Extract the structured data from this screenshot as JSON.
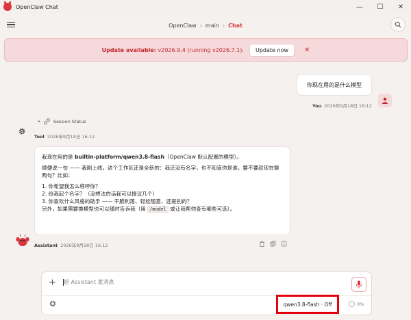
{
  "window": {
    "title": "OpenClaw Chat",
    "icon": "lobster-icon",
    "controls": [
      "—",
      "☐",
      "✕"
    ]
  },
  "header": {
    "breadcrumb": [
      "OpenClaw",
      "main",
      "Chat"
    ],
    "separator": "›"
  },
  "banner": {
    "label": "Update available:",
    "message": " v2026.9.4 (running v2026.7.1).",
    "button": "Update now",
    "close": "✕"
  },
  "user_message": {
    "text": "你现在用的是什么模型",
    "sender": "You",
    "timestamp": "2026年9月18日 16:12"
  },
  "tool": {
    "status_label": "Session Status",
    "sender": "Tool",
    "timestamp": "2026年9月18日 16:12"
  },
  "assistant_message": {
    "line1_prefix": "我现在用的是 ",
    "line1_model": "builtin-platform/qwen3.8-flash",
    "line1_suffix": "（OpenClaw 默认配置的模型）。",
    "para2": "顺便说一句 —— 我刚上线，这个工作区还是全新的：我还没有名字，也不知道你是谁。要不要趁现在聊两句？比如：",
    "items": [
      "1. 你希望我怎么称呼你？",
      "2. 给我起个名字？（没想法的话我可以提议几个）",
      "3. 你喜欢什么风格的助手 —— 干脆利落、轻松随意、还是别的？"
    ],
    "footer_prefix": "另外，如果需要换模型也可以随时告诉我（用 ",
    "footer_code": "/model",
    "footer_suffix": " 或让我帮你查有哪些可选）。",
    "sender": "Assistant",
    "timestamp": "2026年9月18日 16:12"
  },
  "composer": {
    "placeholder": "给 Assistant 发消息",
    "model": "qwen3.8-flash · Off",
    "context": "0%"
  },
  "colors": {
    "accent": "#d9363e",
    "banner_bg": "#f6dadb",
    "highlight_box": "#e3000f"
  }
}
